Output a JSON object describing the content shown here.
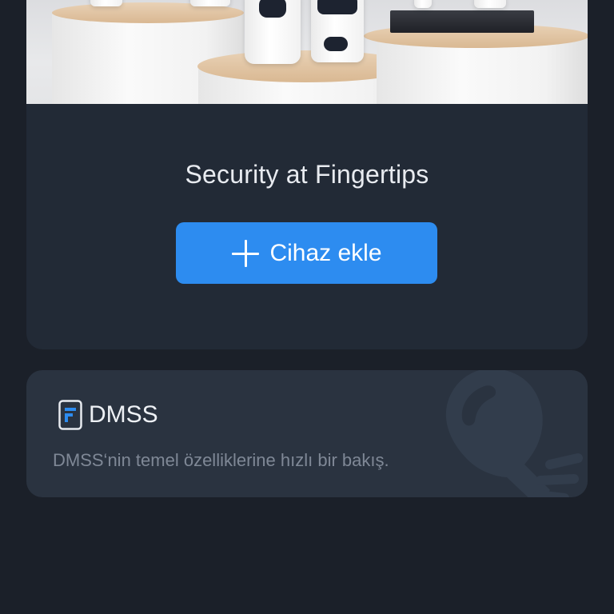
{
  "promo": {
    "hero_image": "security-cameras-product-photo",
    "tagline": "Security at Fingertips",
    "add_device_label": "Cihaz ekle",
    "add_device_icon": "plus-icon"
  },
  "info_card": {
    "icon": "document-icon",
    "title": "DMSS",
    "description": "DMSS‘nin temel özelliklerine hızlı bir bakış.",
    "decoration_icon": "lightbulb-icon"
  },
  "colors": {
    "background": "#1b2029",
    "card": "#222a36",
    "info_card": "#2a3340",
    "accent": "#2d8cf0",
    "secondary_text": "#7f8896"
  }
}
